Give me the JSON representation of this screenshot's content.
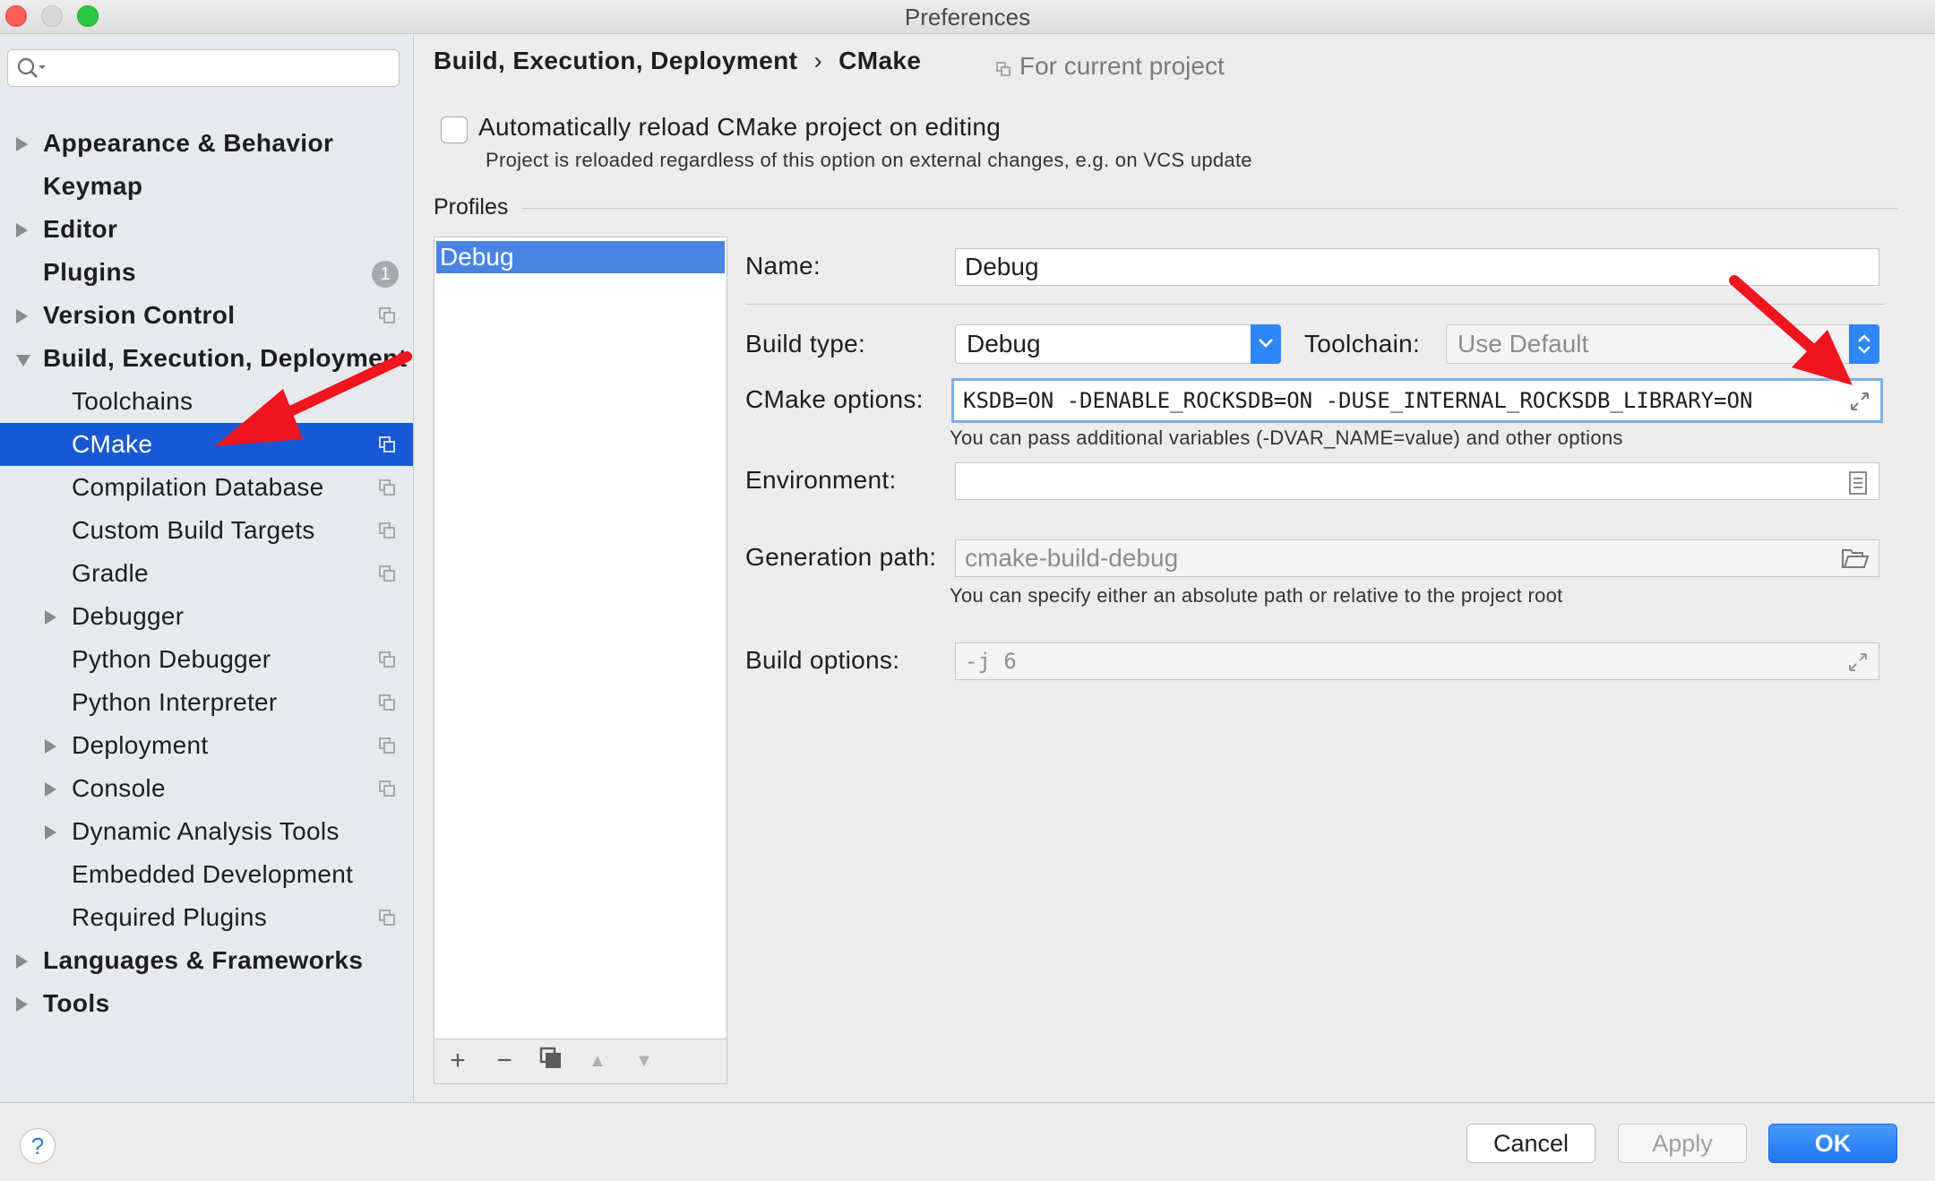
{
  "window": {
    "title": "Preferences"
  },
  "search": {
    "placeholder": ""
  },
  "sidebar": {
    "items": [
      {
        "label": "Appearance & Behavior"
      },
      {
        "label": "Keymap"
      },
      {
        "label": "Editor"
      },
      {
        "label": "Plugins",
        "badge": "1"
      },
      {
        "label": "Version Control"
      },
      {
        "label": "Build, Execution, Deployment"
      },
      {
        "label": "Toolchains"
      },
      {
        "label": "CMake"
      },
      {
        "label": "Compilation Database"
      },
      {
        "label": "Custom Build Targets"
      },
      {
        "label": "Gradle"
      },
      {
        "label": "Debugger"
      },
      {
        "label": "Python Debugger"
      },
      {
        "label": "Python Interpreter"
      },
      {
        "label": "Deployment"
      },
      {
        "label": "Console"
      },
      {
        "label": "Dynamic Analysis Tools"
      },
      {
        "label": "Embedded Development"
      },
      {
        "label": "Required Plugins"
      },
      {
        "label": "Languages & Frameworks"
      },
      {
        "label": "Tools"
      }
    ]
  },
  "header": {
    "breadcrumb_parent": "Build, Execution, Deployment",
    "breadcrumb_sep": "›",
    "breadcrumb_current": "CMake",
    "scope": "For current project"
  },
  "auto_reload": {
    "label": "Automatically reload CMake project on editing",
    "hint": "Project is reloaded regardless of this option on external changes, e.g. on VCS update",
    "checked": false
  },
  "profiles": {
    "section_label": "Profiles",
    "items": [
      "Debug"
    ],
    "toolbar": {
      "add": "+",
      "remove": "−",
      "copy": "copy-icon",
      "up": "▲",
      "down": "▼"
    }
  },
  "form": {
    "name_label": "Name:",
    "name_value": "Debug",
    "build_type_label": "Build type:",
    "build_type_value": "Debug",
    "toolchain_label": "Toolchain:",
    "toolchain_value": "Use Default",
    "cmake_options_label": "CMake options:",
    "cmake_options_value": "KSDB=ON -DENABLE_ROCKSDB=ON -DUSE_INTERNAL_ROCKSDB_LIBRARY=ON",
    "cmake_options_hint": "You can pass additional variables (-DVAR_NAME=value) and other options",
    "environment_label": "Environment:",
    "environment_value": "",
    "generation_path_label": "Generation path:",
    "generation_path_value": "cmake-build-debug",
    "generation_path_hint": "You can specify either an absolute path or relative to the project root",
    "build_options_label": "Build options:",
    "build_options_value": "-j 6"
  },
  "footer": {
    "help": "?",
    "cancel": "Cancel",
    "apply": "Apply",
    "ok": "OK"
  },
  "colors": {
    "selection": "#1759d4",
    "accent": "#2f86f6",
    "annotation_arrow": "#f0141e"
  }
}
